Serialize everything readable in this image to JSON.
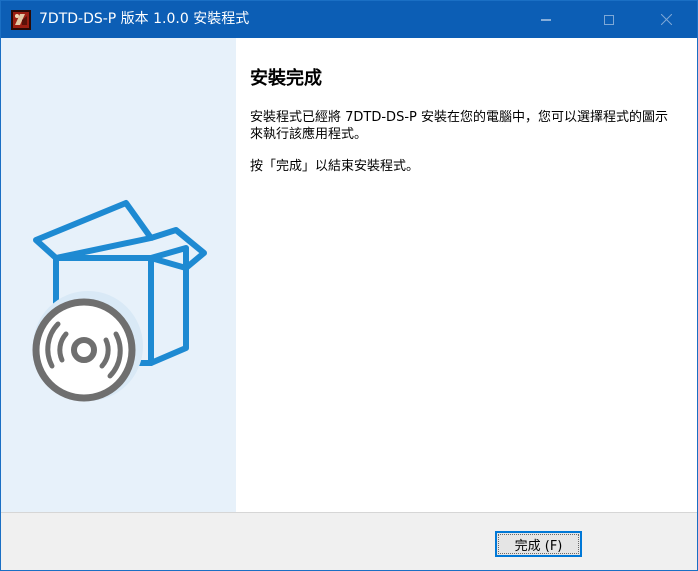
{
  "window": {
    "title": "7DTD-DS-P 版本 1.0.0 安裝程式"
  },
  "titlebar": {
    "icons": {
      "app": "app-icon",
      "minimize": "minimize-icon",
      "maximize": "maximize-icon",
      "close": "close-icon"
    }
  },
  "sidebar": {
    "image": "installer-box-disc-icon",
    "colors": {
      "background": "#e7f1fa",
      "box_stroke": "#1e8ad2",
      "disc": "#6f6f6f"
    }
  },
  "content": {
    "heading": "安裝完成",
    "paragraph1": "安裝程式已經將 7DTD-DS-P 安裝在您的電腦中，您可以選擇程式的圖示來執行該應用程式。",
    "paragraph2": "按「完成」以結束安裝程式。"
  },
  "footer": {
    "finish_label": "完成 (F)"
  },
  "colors": {
    "titlebar": "#0c5eb5",
    "accent": "#0078d7"
  }
}
